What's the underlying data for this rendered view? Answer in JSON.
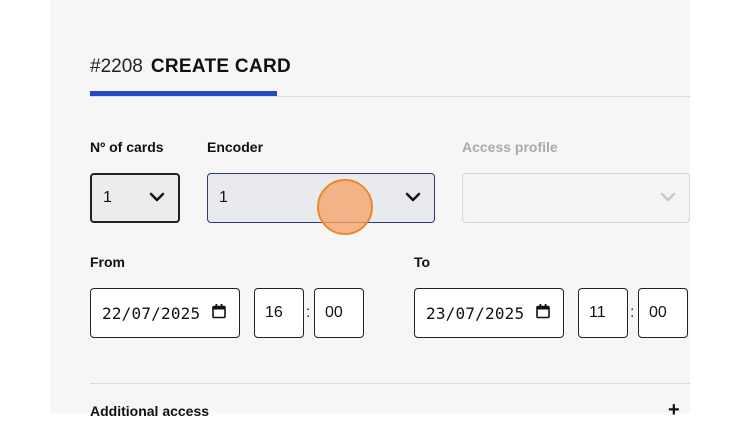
{
  "header": {
    "number": "#2208",
    "title": "CREATE CARD"
  },
  "fields": {
    "num_cards": {
      "label": "Nº of cards",
      "value": "1"
    },
    "encoder": {
      "label": "Encoder",
      "value": "1"
    },
    "access_profile": {
      "label": "Access profile",
      "value": ""
    }
  },
  "from": {
    "label": "From",
    "date": "22/07/2025",
    "hour": "16",
    "minute": "00"
  },
  "to": {
    "label": "To",
    "date": "23/07/2025",
    "hour": "11",
    "minute": "00"
  },
  "additional": {
    "label": "Additional access"
  },
  "time_separator": ":",
  "colors": {
    "accent": "#2747c9",
    "cursor": "#f5a064"
  }
}
